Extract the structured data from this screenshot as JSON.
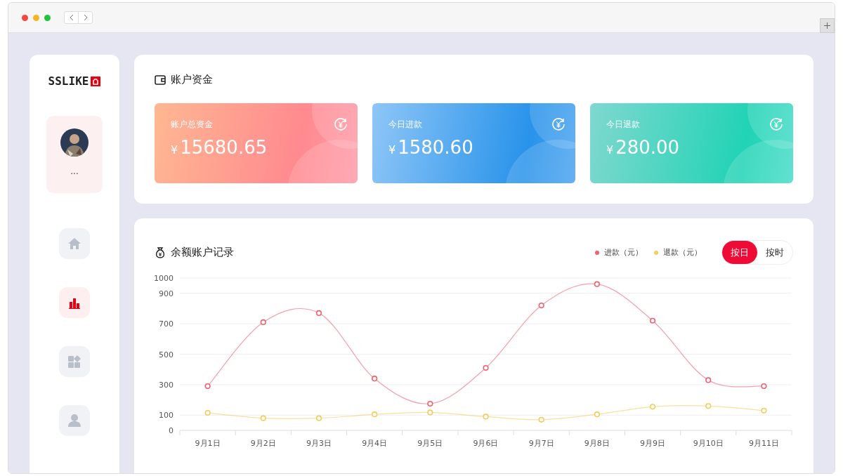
{
  "logo": {
    "text": "SSLIKE"
  },
  "user": {
    "name": "..."
  },
  "nav": [
    {
      "selected": false
    },
    {
      "selected": true
    },
    {
      "selected": false
    },
    {
      "selected": false
    }
  ],
  "funds": {
    "title": "账户资金",
    "cards": [
      {
        "kind": "orange",
        "label": "账户总资金",
        "currency": "¥",
        "amount": "15680.65"
      },
      {
        "kind": "blue",
        "label": "今日进款",
        "currency": "¥",
        "amount": "1580.60"
      },
      {
        "kind": "green",
        "label": "今日退款",
        "currency": "¥",
        "amount": "280.00"
      }
    ]
  },
  "records": {
    "title": "余额账户记录",
    "toggle": [
      {
        "label": "按日",
        "selected": true
      },
      {
        "label": "按时",
        "selected": false
      }
    ],
    "chart_data": {
      "type": "line",
      "categories": [
        "9月1日",
        "9月2日",
        "9月3日",
        "9月4日",
        "9月5日",
        "9月6日",
        "9月7日",
        "9月8日",
        "9月9日",
        "9月10日",
        "9月11日"
      ],
      "yticks": [
        0,
        100,
        300,
        500,
        700,
        900,
        1000
      ],
      "ylim": [
        0,
        1000
      ],
      "grid": true,
      "series": [
        {
          "name": "进款（元）",
          "color": "#f0606e",
          "marker": "circle",
          "values": [
            290,
            710,
            770,
            340,
            175,
            410,
            820,
            960,
            720,
            330,
            290
          ]
        },
        {
          "name": "退款（元）",
          "color": "#f5cb5c",
          "marker": "circle",
          "values": [
            115,
            80,
            80,
            105,
            118,
            90,
            70,
            105,
            155,
            160,
            130
          ]
        }
      ]
    }
  }
}
